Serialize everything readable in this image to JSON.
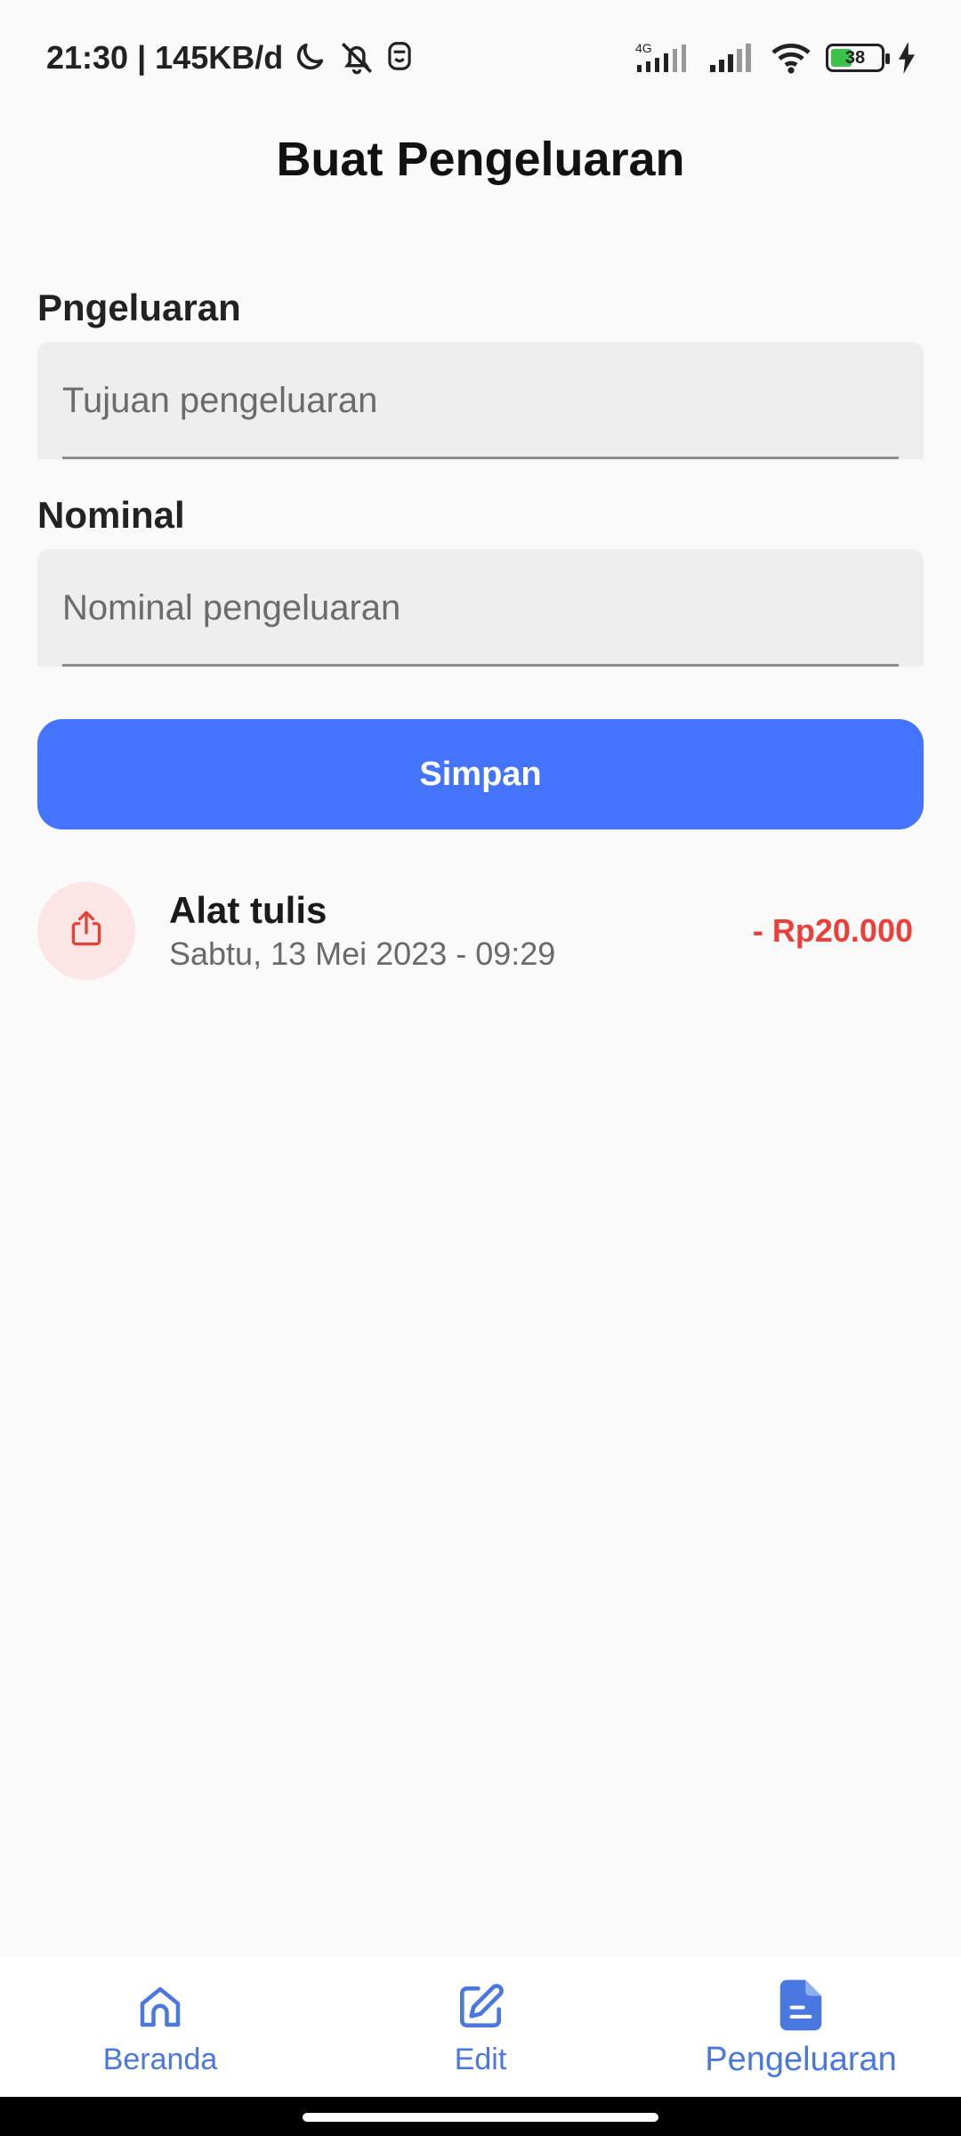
{
  "status_bar": {
    "time_speed": "21:30 | 145KB/d",
    "network_label": "4G",
    "battery_level": "38"
  },
  "header": {
    "title": "Buat Pengeluaran"
  },
  "form": {
    "purpose_label": "Pngeluaran",
    "purpose_placeholder": "Tujuan pengeluaran",
    "amount_label": "Nominal",
    "amount_placeholder": "Nominal pengeluaran",
    "save_label": "Simpan"
  },
  "expenses": [
    {
      "title": "Alat tulis",
      "date": "Sabtu, 13 Mei 2023 - 09:29",
      "amount": "- Rp20.000",
      "icon": "share-upload-icon"
    }
  ],
  "bottom_nav": {
    "items": [
      {
        "label": "Beranda",
        "icon": "home-icon"
      },
      {
        "label": "Edit",
        "icon": "edit-icon"
      },
      {
        "label": "Pengeluaran",
        "icon": "document-icon",
        "active": true
      }
    ]
  },
  "colors": {
    "accent": "#4474fb",
    "expense_red": "#e8413a",
    "nav_blue": "#4a78e0"
  }
}
